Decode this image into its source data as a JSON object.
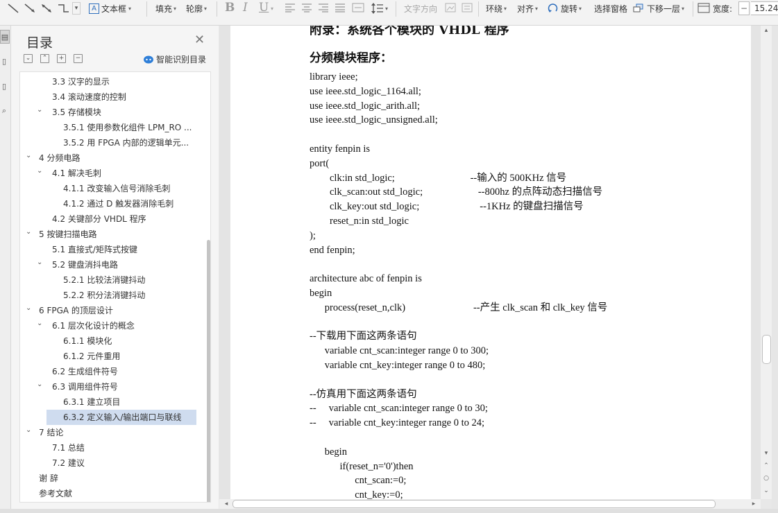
{
  "toolbar": {
    "textbox": "文本框",
    "fill": "填充",
    "outline": "轮廓",
    "bold": "B",
    "italic": "I",
    "underline": "U",
    "text_direction": "文字方向",
    "wrap": "环绕",
    "align": "对齐",
    "rotate": "旋转",
    "selection_pane": "选择窗格",
    "send_back": "下移一层",
    "width_label": "宽度:",
    "width_value": "15.24"
  },
  "toc": {
    "title": "目录",
    "smart": "智能识别目录",
    "items": [
      {
        "label": "3.3  汉字的显示",
        "level": 2,
        "expanded": null,
        "selected": false
      },
      {
        "label": "3.4  滚动速度的控制",
        "level": 2,
        "expanded": null,
        "selected": false
      },
      {
        "label": "3.5 存储模块",
        "level": 2,
        "expanded": true,
        "selected": false
      },
      {
        "label": "3.5.1  使用参数化组件 LPM_RO ...",
        "level": 3,
        "expanded": null,
        "selected": false
      },
      {
        "label": "3.5.2  用 FPGA 内部的逻辑单元...",
        "level": 3,
        "expanded": null,
        "selected": false
      },
      {
        "label": "4  分频电路",
        "level": 1,
        "expanded": true,
        "selected": false
      },
      {
        "label": "4.1  解决毛刺",
        "level": 2,
        "expanded": true,
        "selected": false
      },
      {
        "label": "4.1.1  改变输入信号消除毛刺",
        "level": 3,
        "expanded": null,
        "selected": false
      },
      {
        "label": "4.1.2  通过 D 触发器消除毛刺",
        "level": 3,
        "expanded": null,
        "selected": false
      },
      {
        "label": "4.2  关键部分 VHDL 程序",
        "level": 2,
        "expanded": null,
        "selected": false
      },
      {
        "label": "5  按键扫描电路",
        "level": 1,
        "expanded": true,
        "selected": false
      },
      {
        "label": "5.1  直接式/矩阵式按键",
        "level": 2,
        "expanded": null,
        "selected": false
      },
      {
        "label": "5.2  键盘消抖电路",
        "level": 2,
        "expanded": true,
        "selected": false
      },
      {
        "label": "5.2.1  比较法消键抖动",
        "level": 3,
        "expanded": null,
        "selected": false
      },
      {
        "label": "5.2.2  积分法消键抖动",
        "level": 3,
        "expanded": null,
        "selected": false
      },
      {
        "label": "6 FPGA 的顶层设计",
        "level": 1,
        "expanded": true,
        "selected": false
      },
      {
        "label": "6.1  层次化设计的概念",
        "level": 2,
        "expanded": true,
        "selected": false
      },
      {
        "label": "6.1.1  模块化",
        "level": 3,
        "expanded": null,
        "selected": false
      },
      {
        "label": "6.1.2  元件重用",
        "level": 3,
        "expanded": null,
        "selected": false
      },
      {
        "label": "6.2  生成组件符号",
        "level": 2,
        "expanded": null,
        "selected": false
      },
      {
        "label": "6.3  调用组件符号",
        "level": 2,
        "expanded": true,
        "selected": false
      },
      {
        "label": "6.3.1  建立项目",
        "level": 3,
        "expanded": null,
        "selected": false
      },
      {
        "label": "6.3.2  定义输入/输出端口与联线",
        "level": 3,
        "expanded": null,
        "selected": true
      },
      {
        "label": "7  结论",
        "level": 1,
        "expanded": true,
        "selected": false
      },
      {
        "label": "7.1  总结",
        "level": 2,
        "expanded": null,
        "selected": false
      },
      {
        "label": "7.2  建议",
        "level": 2,
        "expanded": null,
        "selected": false
      },
      {
        "label": "谢  辞",
        "level": 1,
        "expanded": null,
        "selected": false
      },
      {
        "label": "参考文献",
        "level": 1,
        "expanded": null,
        "selected": false
      }
    ]
  },
  "doc": {
    "heading1": "附录：系统各个模块的 VHDL 程序",
    "heading2": "分频模块程序：",
    "lines": [
      "library ieee;",
      "use ieee.std_logic_1164.all;",
      "use ieee.std_logic_arith.all;",
      "use ieee.std_logic_unsigned.all;",
      "",
      "entity fenpin is",
      "port(",
      "        clk:in std_logic;                              --输入的 500KHz 信号",
      "        clk_scan:out std_logic;                      --800hz 的点阵动态扫描信号",
      "        clk_key:out std_logic;                        --1KHz 的键盘扫描信号",
      "        reset_n:in std_logic",
      ");",
      "end fenpin;",
      "",
      "architecture abc of fenpin is",
      "begin",
      "      process(reset_n,clk)                           --产生 clk_scan 和 clk_key 信号",
      "",
      "--下载用下面这两条语句",
      "      variable cnt_scan:integer range 0 to 300;",
      "      variable cnt_key:integer range 0 to 480;",
      "",
      "--仿真用下面这两条语句",
      "--     variable cnt_scan:integer range 0 to 30;",
      "--     variable cnt_key:integer range 0 to 24;",
      "",
      "      begin",
      "            if(reset_n='0')then",
      "                  cnt_scan:=0;",
      "                  cnt_key:=0;"
    ]
  }
}
